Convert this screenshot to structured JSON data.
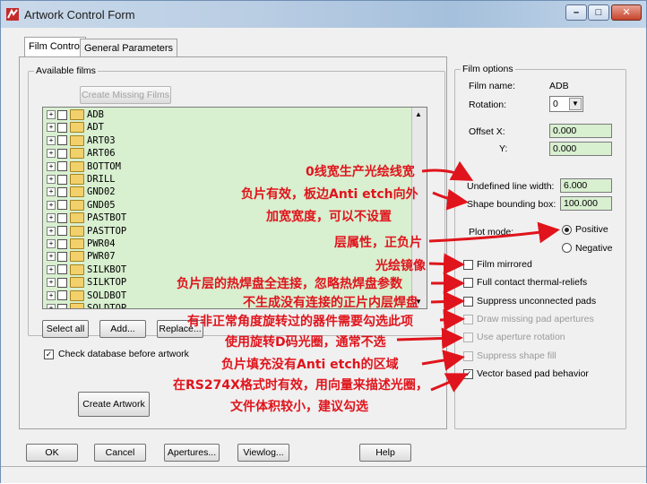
{
  "window": {
    "title": "Artwork Control Form",
    "icon": "artwork-app-icon"
  },
  "tabs": [
    {
      "label": "Film Control",
      "active": true
    },
    {
      "label": "General Parameters",
      "active": false
    }
  ],
  "available_films": {
    "group_label": "Available films",
    "create_missing_label": "Create Missing Films",
    "items": [
      "ADB",
      "ADT",
      "ART03",
      "ART06",
      "BOTTOM",
      "DRILL",
      "GND02",
      "GND05",
      "PASTBOT",
      "PASTTOP",
      "PWR04",
      "PWR07",
      "SILKBOT",
      "SILKTOP",
      "SOLDBOT",
      "SOLDTOP"
    ],
    "select_all_label": "Select all",
    "add_label": "Add...",
    "replace_label": "Replace...",
    "check_db_label": "Check database before artwork",
    "check_db_checked": true,
    "create_artwork_label": "Create Artwork"
  },
  "film_options": {
    "group_label": "Film options",
    "film_name_label": "Film name:",
    "film_name_value": "ADB",
    "rotation_label": "Rotation:",
    "rotation_value": "0",
    "offset_label": "Offset  X:",
    "offset_y_label": "Y:",
    "offset_x_value": "0.000",
    "offset_y_value": "0.000",
    "undefined_line_label": "Undefined line width:",
    "undefined_line_value": "6.000",
    "shape_bbox_label": "Shape bounding box:",
    "shape_bbox_value": "100.000",
    "plot_mode_label": "Plot mode:",
    "positive_label": "Positive",
    "negative_label": "Negative",
    "options": [
      {
        "label": "Film mirrored",
        "checked": false,
        "enabled": true
      },
      {
        "label": "Full contact thermal-reliefs",
        "checked": false,
        "enabled": true
      },
      {
        "label": "Suppress unconnected pads",
        "checked": false,
        "enabled": true
      },
      {
        "label": "Draw missing pad apertures",
        "checked": false,
        "enabled": false
      },
      {
        "label": "Use aperture rotation",
        "checked": false,
        "enabled": false
      },
      {
        "label": "Suppress shape fill",
        "checked": false,
        "enabled": false
      },
      {
        "label": "Vector based pad behavior",
        "checked": true,
        "enabled": true
      }
    ]
  },
  "bottom_buttons": [
    "OK",
    "Cancel",
    "Apertures...",
    "Viewlog...",
    "Help"
  ],
  "annotations": [
    "0线宽生产光绘线宽",
    "负片有效，板边Anti etch向外",
    "加宽宽度，可以不设置",
    "层属性，正负片",
    "光绘镜像",
    "负片层的热焊盘全连接，忽略热焊盘参数",
    "不生成没有连接的正片内层焊盘",
    "有非正常角度旋转过的器件需要勾选此项",
    "使用旋转D码光圈，通常不选",
    "负片填充没有Anti etch的区域",
    "在RS274X格式时有效，用向量来描述光圈，",
    "文件体积较小，建议勾选"
  ],
  "colors": {
    "annotation": "#e0141c",
    "field_bg": "#d8efd0",
    "arrow": "#e0141c"
  }
}
